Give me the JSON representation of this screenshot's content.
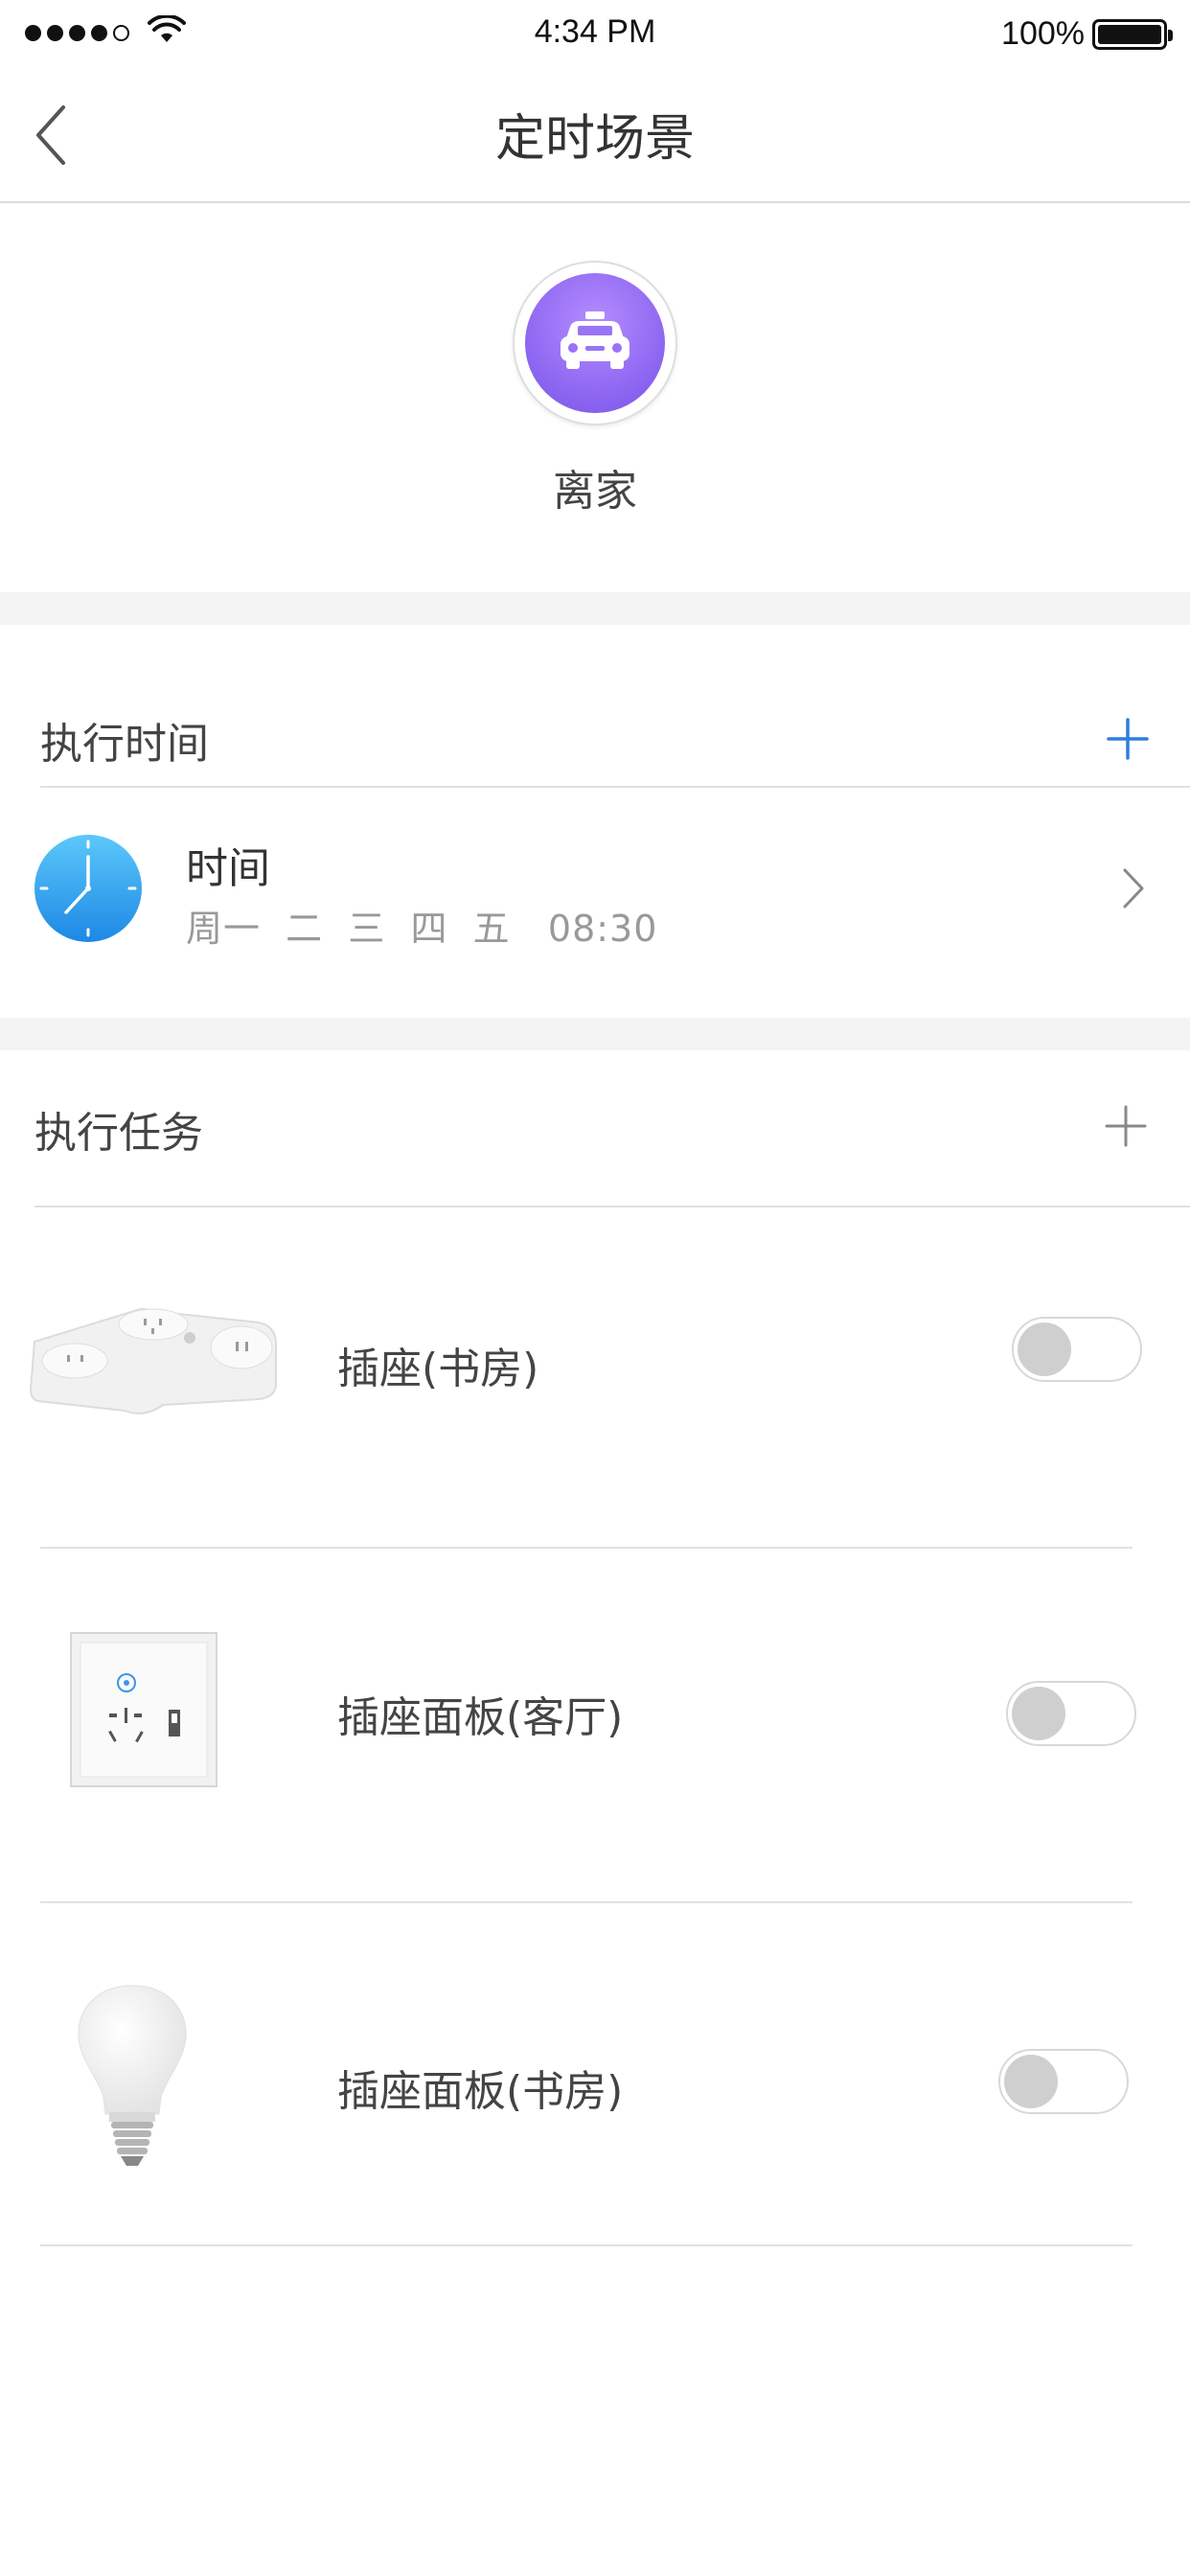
{
  "status_bar": {
    "time": "4:34 PM",
    "battery": "100%",
    "signal_bars": 4
  },
  "nav": {
    "title": "定时场景",
    "back_icon": "chevron-left-icon"
  },
  "scene": {
    "name": "离家",
    "icon": "car-icon",
    "accent": "#8a63f0"
  },
  "schedule": {
    "header": "执行时间",
    "add_icon": "plus-icon",
    "add_color": "#2f7de1",
    "item": {
      "label": "时间",
      "days": "周一  二  三  四  五",
      "time": "08:30",
      "icon": "clock-icon"
    }
  },
  "tasks": {
    "header": "执行任务",
    "add_icon": "plus-icon",
    "items": [
      {
        "name": "插座(书房)",
        "icon": "power-strip-icon",
        "enabled": false
      },
      {
        "name": "插座面板(客厅)",
        "icon": "wall-socket-icon",
        "enabled": false
      },
      {
        "name": "插座面板(书房)",
        "icon": "light-bulb-icon",
        "enabled": false
      }
    ]
  }
}
